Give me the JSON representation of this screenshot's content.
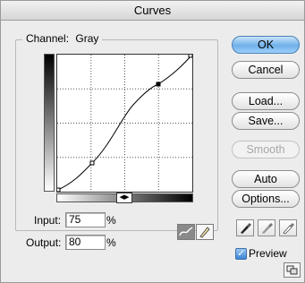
{
  "window": {
    "title": "Curves"
  },
  "channel": {
    "label": "Channel:",
    "value": "Gray"
  },
  "graph": {
    "input_value": 75,
    "output_value": 80
  },
  "input": {
    "label": "Input:",
    "value": "75",
    "unit": "%"
  },
  "output": {
    "label": "Output:",
    "value": "80",
    "unit": "%"
  },
  "buttons": {
    "ok": "OK",
    "cancel": "Cancel",
    "load": "Load...",
    "save": "Save...",
    "smooth": "Smooth",
    "auto": "Auto",
    "options": "Options..."
  },
  "preview": {
    "label": "Preview",
    "checked": true
  },
  "colors": {
    "default_button": "#6fb0ea",
    "graph_bg": "#ffffff"
  }
}
